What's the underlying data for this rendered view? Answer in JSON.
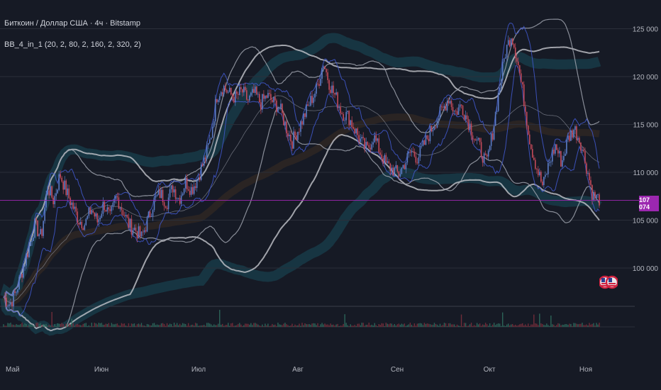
{
  "header": {
    "symbol_title": "Биткоин / Доллар США · 4ч · Bitstamp",
    "indicator_title": "BB_4_in_1 (20, 2, 80, 2, 160, 2, 320, 2)"
  },
  "price_tag": {
    "value": "107 074",
    "color": "#9c27b0"
  },
  "colors": {
    "background": "#161a25",
    "grid": "#2a2e39",
    "candle_up": "#5b7cc7",
    "candle_down": "#c44a5a",
    "bb20": "#3f56c8",
    "bb80": "#9ea2ad",
    "bb160": "#c4c6cc",
    "bb320_glow": "#1b6a78",
    "bb320_glow_alt": "#5a3a20",
    "current_line": "#9c27b0"
  },
  "chart_data": {
    "type": "candlestick",
    "title": "Биткоин / Доллар США · 4ч · Bitstamp",
    "y_axis": {
      "ticks": [
        100000,
        105000,
        110000,
        115000,
        120000,
        125000
      ],
      "tick_labels": [
        "100 000",
        "105 000",
        "110 000",
        "115 000",
        "120 000",
        "125 000"
      ],
      "range": [
        96000,
        128000
      ]
    },
    "x_axis": {
      "labels": [
        "Май",
        "Июн",
        "Июл",
        "Авг",
        "Сен",
        "Окт",
        "Ноя"
      ]
    },
    "current_price": 107074,
    "approx_close_series": [
      97000,
      96200,
      97500,
      99800,
      102000,
      104500,
      103200,
      108500,
      107000,
      109800,
      108000,
      106500,
      105000,
      104600,
      106200,
      104800,
      106800,
      105200,
      107500,
      106000,
      104500,
      104000,
      103200,
      105000,
      107000,
      107800,
      106800,
      108500,
      107200,
      109000,
      108200,
      109500,
      111200,
      113500,
      118000,
      119000,
      118200,
      117800,
      118500,
      117500,
      118300,
      117200,
      118000,
      117300,
      116800,
      114800,
      113200,
      114500,
      116000,
      117500,
      118800,
      121500,
      119200,
      117800,
      116200,
      115800,
      114500,
      113200,
      112300,
      113800,
      112200,
      110800,
      110300,
      109800,
      111000,
      112200,
      111500,
      112800,
      114200,
      115500,
      116500,
      117800,
      116200,
      117000,
      115500,
      113800,
      112500,
      110800,
      114200,
      118500,
      122500,
      124500,
      121500,
      117500,
      113000,
      110500,
      108500,
      111000,
      112800,
      111000,
      113500,
      114600,
      113200,
      110500,
      107500,
      107200
    ],
    "indicators": [
      {
        "name": "BB 20",
        "length": 20,
        "mult": 2
      },
      {
        "name": "BB 80",
        "length": 80,
        "mult": 2
      },
      {
        "name": "BB 160",
        "length": 160,
        "mult": 2
      },
      {
        "name": "BB 320",
        "length": 320,
        "mult": 2
      }
    ],
    "volume": "bars at bottom pane, small, with occasional spikes"
  }
}
